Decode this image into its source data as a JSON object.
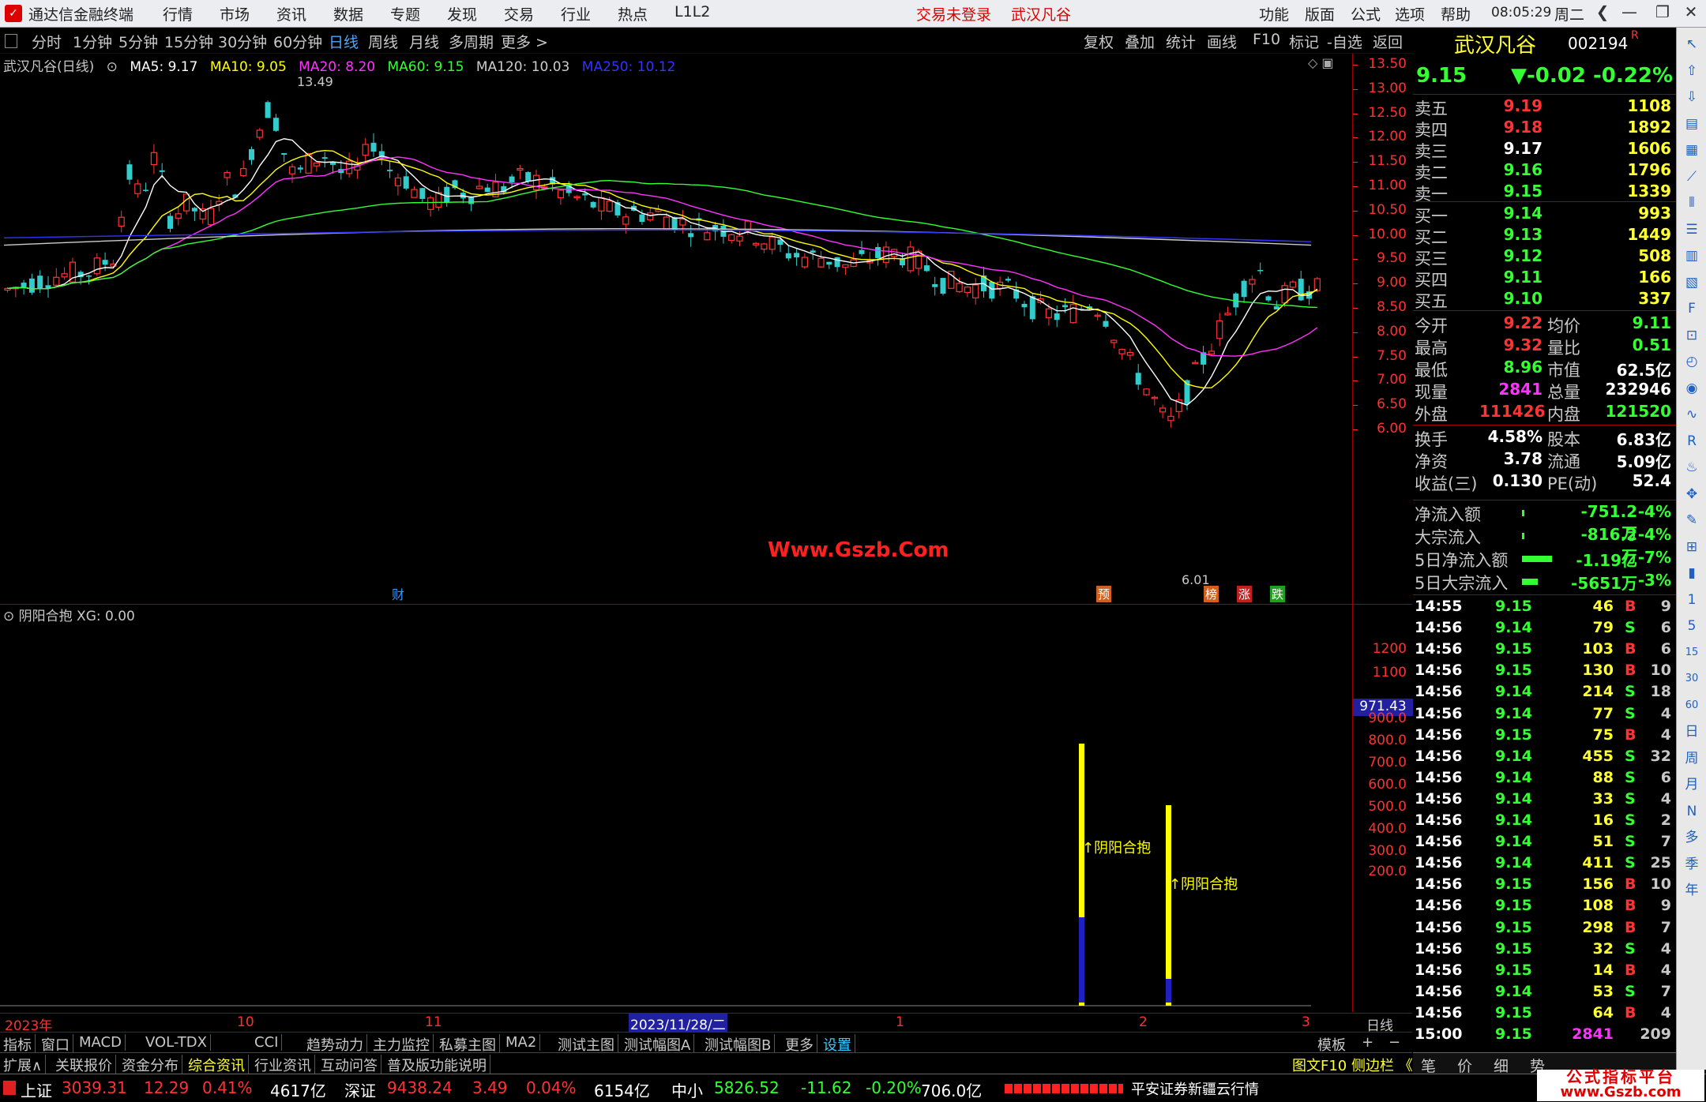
{
  "menubar": {
    "app_title": "通达信金融终端",
    "items": [
      "行情",
      "市场",
      "资讯",
      "数据",
      "专题",
      "发现",
      "交易",
      "行业",
      "热点",
      "L1L2"
    ],
    "login_status": "交易未登录",
    "stock_name": "武汉凡谷",
    "right_items": [
      "功能",
      "版面",
      "公式",
      "选项",
      "帮助"
    ],
    "time": "08:05:29",
    "weekday": "周二"
  },
  "periodbar": {
    "tabs": [
      "分时",
      "1分钟",
      "5分钟",
      "15分钟",
      "30分钟",
      "60分钟",
      "日线",
      "周线",
      "月线",
      "多周期",
      "更多 >"
    ],
    "active_index": 6,
    "right_tabs": [
      "复权",
      "叠加",
      "统计",
      "画线",
      "F10",
      "标记",
      "-自选",
      "返回"
    ]
  },
  "mainchart": {
    "title": "武汉凡谷(日线)",
    "ma_labels": [
      {
        "text": "MA5: 9.17",
        "color": "#ffffff"
      },
      {
        "text": "MA10: 9.05",
        "color": "#ffff00"
      },
      {
        "text": "MA20: 8.20",
        "color": "#ff33ff"
      },
      {
        "text": "MA60: 9.15",
        "color": "#33ff33"
      },
      {
        "text": "MA120: 10.03",
        "color": "#cccccc"
      },
      {
        "text": "MA250: 10.12",
        "color": "#3333ff"
      }
    ],
    "price_axis": [
      "13.50",
      "13.00",
      "12.50",
      "12.00",
      "11.50",
      "11.00",
      "10.50",
      "10.00",
      "9.50",
      "9.00",
      "8.50",
      "8.00",
      "7.50",
      "7.00",
      "6.50",
      "6.00"
    ],
    "high_label": "13.49",
    "low_label": "6.01",
    "watermark": "Www.Gszb.Com",
    "markers": [
      {
        "text": "财",
        "color": "#3399ff"
      },
      {
        "text": "预",
        "color": "#ff9933"
      },
      {
        "text": "榜",
        "color": "#ff9933"
      },
      {
        "text": "涨",
        "color": "#ff3333"
      },
      {
        "text": "跌",
        "color": "#33ff33"
      }
    ]
  },
  "indicator": {
    "title": "阴阳合抱 XG: 0.00",
    "axis": [
      "1200",
      "1100",
      "900.0",
      "800.0",
      "700.0",
      "600.0",
      "500.0",
      "400.0",
      "300.0",
      "200.0"
    ],
    "current_value": "971.43",
    "signal_label": "阴阳合抱"
  },
  "dateaxis": {
    "labels": [
      "2023年",
      "10",
      "11",
      "2023/11/28/二",
      "1",
      "2",
      "3"
    ],
    "period": "日线"
  },
  "tabbar1": {
    "tabs": [
      "指标",
      "窗口",
      "MACD",
      "VOL-TDX",
      "CCI",
      "趋势动力",
      "主力监控",
      "私募主图",
      "MA2",
      "测试主图",
      "测试幅图A",
      "测试幅图B",
      "更多",
      "设置"
    ],
    "right": [
      "模板",
      "+",
      "−"
    ]
  },
  "tabbar2": {
    "tabs": [
      "扩展∧",
      "关联报价",
      "资金分布",
      "综合资讯",
      "行业资讯",
      "互动问答",
      "普及版功能说明"
    ],
    "right": "图文F10 侧边栏 《"
  },
  "quote": {
    "name": "武汉凡谷",
    "code": "002194",
    "badge": "R",
    "price": "9.15",
    "change": "▼-0.02",
    "change_pct": "-0.22%",
    "asks": [
      {
        "label": "卖五",
        "price": "9.19",
        "vol": "1108",
        "pc": "#ff3333"
      },
      {
        "label": "卖四",
        "price": "9.18",
        "vol": "1892",
        "pc": "#ff3333"
      },
      {
        "label": "卖三",
        "price": "9.17",
        "vol": "1606",
        "pc": "#ffffff"
      },
      {
        "label": "卖二",
        "price": "9.16",
        "vol": "1796",
        "pc": "#33ff33"
      },
      {
        "label": "卖一",
        "price": "9.15",
        "vol": "1339",
        "pc": "#33ff33"
      }
    ],
    "bids": [
      {
        "label": "买一",
        "price": "9.14",
        "vol": "993",
        "pc": "#33ff33"
      },
      {
        "label": "买二",
        "price": "9.13",
        "vol": "1449",
        "pc": "#33ff33"
      },
      {
        "label": "买三",
        "price": "9.12",
        "vol": "508",
        "pc": "#33ff33"
      },
      {
        "label": "买四",
        "price": "9.11",
        "vol": "166",
        "pc": "#33ff33"
      },
      {
        "label": "买五",
        "price": "9.10",
        "vol": "337",
        "pc": "#33ff33"
      }
    ],
    "stats": [
      {
        "l1": "今开",
        "v1": "9.22",
        "c1": "#ff3333",
        "l2": "均价",
        "v2": "9.11",
        "c2": "#33ff33"
      },
      {
        "l1": "最高",
        "v1": "9.32",
        "c1": "#ff3333",
        "l2": "量比",
        "v2": "0.51",
        "c2": "#33ff33"
      },
      {
        "l1": "最低",
        "v1": "8.96",
        "c1": "#33ff33",
        "l2": "市值",
        "v2": "62.5亿",
        "c2": "#ffffff"
      },
      {
        "l1": "现量",
        "v1": "2841",
        "c1": "#ff33ff",
        "l2": "总量",
        "v2": "232946",
        "c2": "#ffffff"
      },
      {
        "l1": "外盘",
        "v1": "111426",
        "c1": "#ff3333",
        "l2": "内盘",
        "v2": "121520",
        "c2": "#33ff33"
      }
    ],
    "finance": [
      {
        "l1": "换手",
        "v1": "4.58%",
        "l2": "股本",
        "v2": "6.83亿"
      },
      {
        "l1": "净资",
        "v1": "3.78",
        "l2": "流通",
        "v2": "5.09亿"
      },
      {
        "l1": "收益(三)",
        "v1": "0.130",
        "l2": "PE(动)",
        "v2": "52.4"
      }
    ],
    "flows": [
      {
        "label": "净流入额",
        "value": "-751.2万",
        "pct": "-4%",
        "bar": 0.02
      },
      {
        "label": "大宗流入",
        "value": "-816.2万",
        "pct": "-4%",
        "bar": 0.02
      },
      {
        "label": "5日净流入额",
        "value": "-1.19亿",
        "pct": "-7%",
        "bar": 0.6
      },
      {
        "label": "5日大宗流入",
        "value": "-5651万",
        "pct": "-3%",
        "bar": 0.3
      }
    ],
    "ticks": [
      [
        "14:55",
        "9.15",
        "46",
        "B",
        "9"
      ],
      [
        "14:56",
        "9.14",
        "79",
        "S",
        "6"
      ],
      [
        "14:56",
        "9.15",
        "103",
        "B",
        "6"
      ],
      [
        "14:56",
        "9.15",
        "130",
        "B",
        "10"
      ],
      [
        "14:56",
        "9.14",
        "214",
        "S",
        "18"
      ],
      [
        "14:56",
        "9.14",
        "77",
        "S",
        "4"
      ],
      [
        "14:56",
        "9.15",
        "75",
        "B",
        "4"
      ],
      [
        "14:56",
        "9.14",
        "455",
        "S",
        "32"
      ],
      [
        "14:56",
        "9.14",
        "88",
        "S",
        "6"
      ],
      [
        "14:56",
        "9.14",
        "33",
        "S",
        "4"
      ],
      [
        "14:56",
        "9.14",
        "16",
        "S",
        "2"
      ],
      [
        "14:56",
        "9.14",
        "51",
        "S",
        "7"
      ],
      [
        "14:56",
        "9.14",
        "411",
        "S",
        "25"
      ],
      [
        "14:56",
        "9.15",
        "156",
        "B",
        "10"
      ],
      [
        "14:56",
        "9.15",
        "108",
        "B",
        "9"
      ],
      [
        "14:56",
        "9.15",
        "298",
        "B",
        "7"
      ],
      [
        "14:56",
        "9.15",
        "32",
        "S",
        "4"
      ],
      [
        "14:56",
        "9.15",
        "14",
        "B",
        "4"
      ],
      [
        "14:56",
        "9.14",
        "53",
        "S",
        "7"
      ],
      [
        "14:56",
        "9.15",
        "64",
        "B",
        "4"
      ],
      [
        "15:00",
        "9.15",
        "2841",
        "",
        "209"
      ]
    ],
    "bottom_tabs": [
      "笔",
      "价",
      "细",
      "势"
    ]
  },
  "statusbar": {
    "sh_name": "上证",
    "sh_val": "3039.31",
    "sh_chg": "12.29",
    "sh_pct": "0.41%",
    "sh_amt": "4617亿",
    "sz_name": "深证",
    "sz_val": "9438.24",
    "sz_chg": "3.49",
    "sz_pct": "0.04%",
    "sz_amt": "6154亿",
    "zx_name": "中小",
    "zx_val": "5826.52",
    "zx_chg": "-11.62",
    "zx_pct": "-0.20%",
    "zx_amt": "706.0亿",
    "broker": "平安证券新疆云行情",
    "logo_line1": "公式指标平台",
    "logo_line2": "www.Gszb.com"
  },
  "right_icons": [
    "arrow-icon",
    "up-icon",
    "down-icon",
    "chart-icon",
    "grid-icon",
    "line-icon",
    "kline-icon",
    "list-icon",
    "f10-icon",
    "book-icon",
    "f-icon",
    "fs-icon",
    "clock-icon",
    "eye-icon",
    "wave-icon",
    "rsi-icon",
    "fire-icon",
    "move-icon",
    "pen-icon",
    "f5-icon",
    "bar-icon",
    "1-icon",
    "5-icon",
    "15-icon",
    "30-icon",
    "60-icon",
    "day-icon",
    "week-icon",
    "month-icon",
    "n-icon",
    "multi-icon",
    "season-icon",
    "year-icon"
  ],
  "colors": {
    "up": "#ff3333",
    "down": "#33cccc",
    "ma5": "#ffffff",
    "ma10": "#ffff00",
    "ma20": "#ff33ff",
    "ma60": "#33ff33",
    "ma120": "#cccccc",
    "ma250": "#3333ff",
    "grid": "#a00000"
  }
}
